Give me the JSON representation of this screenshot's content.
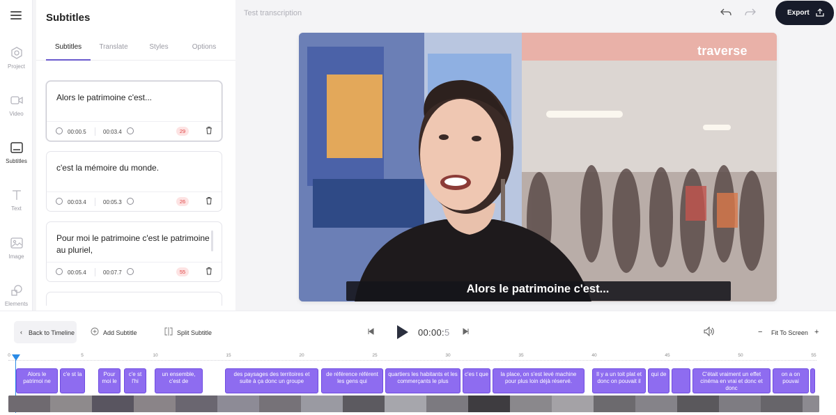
{
  "rail": {
    "items": [
      {
        "label": "Project",
        "icon": "hexagon-icon"
      },
      {
        "label": "Video",
        "icon": "video-camera-icon"
      },
      {
        "label": "Subtitles",
        "icon": "subtitles-icon"
      },
      {
        "label": "Text",
        "icon": "text-icon"
      },
      {
        "label": "Image",
        "icon": "image-icon"
      },
      {
        "label": "Elements",
        "icon": "shapes-icon"
      }
    ]
  },
  "panel": {
    "title": "Subtitles",
    "tabs": [
      "Subtitles",
      "Translate",
      "Styles",
      "Options"
    ],
    "cards": [
      {
        "text": "Alors le patrimoine c'est...",
        "start": "00:00.5",
        "end": "00:03.4",
        "count": "29"
      },
      {
        "text": "c'est la mémoire du monde.",
        "start": "00:03.4",
        "end": "00:05.3",
        "count": "26"
      },
      {
        "text": "Pour moi le patrimoine c'est le patrimoine au pluriel,",
        "start": "00:05.4",
        "end": "00:07.7",
        "count": "55"
      }
    ]
  },
  "header": {
    "doc_title": "Test transcription",
    "export_label": "Export"
  },
  "video": {
    "logo": "traverse",
    "caption": "Alors le patrimoine c'est..."
  },
  "toolbar": {
    "back_label": "Back to Timeline",
    "add_label": "Add Subtitle",
    "split_label": "Split Subtitle",
    "time_main": "00:00:",
    "time_frac": "5",
    "fit_label": "Fit To Screen",
    "zoom_out": "−",
    "zoom_in": "+"
  },
  "ruler": {
    "labels": [
      "0",
      "5",
      "10",
      "15",
      "20",
      "25",
      "30",
      "35",
      "40",
      "45",
      "50",
      "55"
    ]
  },
  "segments": [
    "Alors le patrimoi ne",
    "c'e st la",
    "Pour moi le",
    "c'e st l'hi",
    "un ensemble, c'est de",
    "des paysages des territoires et suite à ça donc un groupe",
    "de référence référent les gens qui",
    "quartiers les habitants et les commerçants le plus",
    "c'es t que",
    "la place, on s'est levé machine pour plus loin déjà réservé.",
    "Il y a un toit plat et donc on pouvait il",
    "qui de",
    "",
    "C'était vraiment un effet cinéma en vrai et donc et donc",
    "on a on pouvai",
    ""
  ],
  "colors": {
    "segment": "#8e6cf0",
    "accent": "#6a5acd",
    "export_bg": "#171b2a",
    "badge_bg": "#fde3e3",
    "badge_text": "#e04444",
    "playhead": "#2b8be6"
  }
}
